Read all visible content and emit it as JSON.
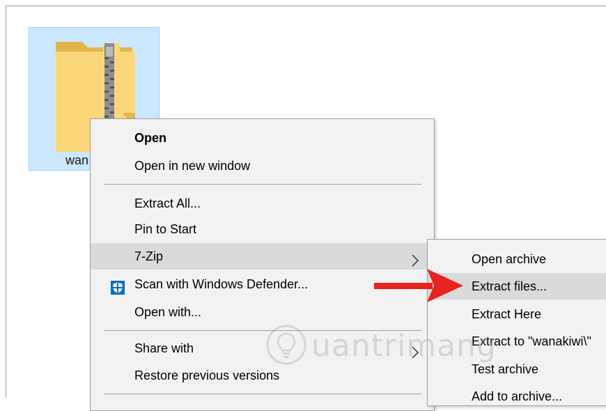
{
  "file": {
    "name": "wan",
    "icon": "zip-folder-icon"
  },
  "context_menu": {
    "items": [
      {
        "label": "Open"
      },
      {
        "label": "Open in new window"
      },
      {
        "label": "Extract All..."
      },
      {
        "label": "Pin to Start"
      },
      {
        "label": "7-Zip",
        "icon": "chevron-right-icon"
      },
      {
        "label": "Scan with Windows Defender...",
        "icon": "windows-defender-icon"
      },
      {
        "label": "Open with..."
      },
      {
        "label": "Share with",
        "icon": "chevron-right-icon"
      },
      {
        "label": "Restore previous versions"
      }
    ],
    "highlighted": "7-Zip"
  },
  "submenu_7zip": {
    "items": [
      {
        "label": "Open archive"
      },
      {
        "label": "Extract files..."
      },
      {
        "label": "Extract Here"
      },
      {
        "label": "Extract to \"wanakiwi\\\""
      },
      {
        "label": "Test archive"
      },
      {
        "label": "Add to archive..."
      }
    ],
    "highlighted": "Extract files..."
  },
  "annotation": {
    "icon": "red-arrow-icon",
    "color": "#e8231f"
  },
  "watermark": {
    "text": "uantrimang",
    "icon": "lightbulb-icon"
  },
  "colors": {
    "selection": "#cce8ff",
    "menu_bg": "#f2f2f2",
    "menu_highlight": "#dadada",
    "defender_blue": "#0a6fc2"
  }
}
